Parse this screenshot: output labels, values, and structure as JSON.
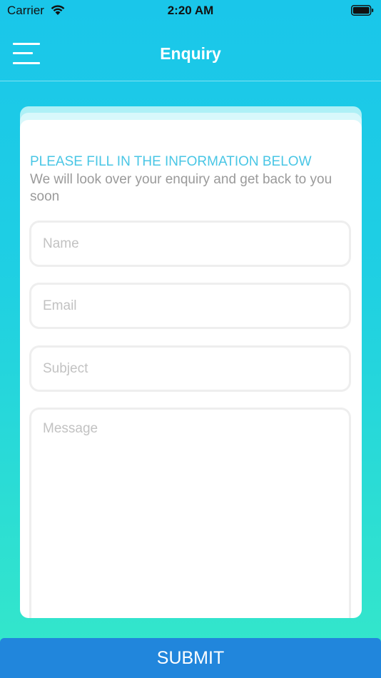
{
  "status_bar": {
    "carrier": "Carrier",
    "time": "2:20 AM",
    "icons": [
      "wifi-icon",
      "battery-icon"
    ]
  },
  "nav": {
    "title": "Enquiry",
    "menu_icon": "hamburger-menu-icon"
  },
  "form": {
    "heading": "PLEASE FILL IN THE INFORMATION BELOW",
    "subheading": "We will look over your enquiry and get back to you soon",
    "fields": {
      "name": {
        "placeholder": "Name",
        "value": ""
      },
      "email": {
        "placeholder": "Email",
        "value": ""
      },
      "subject": {
        "placeholder": "Subject",
        "value": ""
      },
      "message": {
        "placeholder": "Message",
        "value": ""
      }
    },
    "submit_label": "SUBMIT"
  },
  "colors": {
    "gradient_top": "#1ac6ea",
    "gradient_bottom": "#35e8c9",
    "heading": "#49c6e5",
    "submit": "#2186dc"
  }
}
